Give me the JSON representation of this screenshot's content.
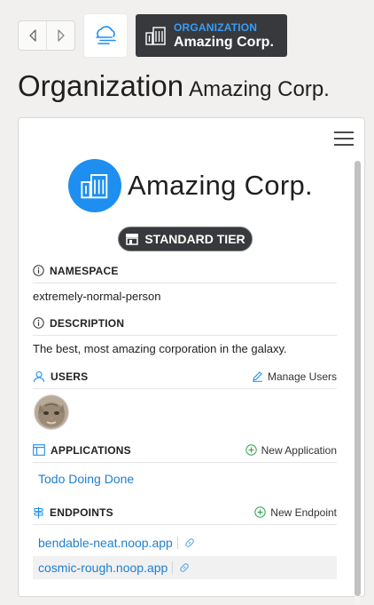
{
  "nav": {
    "back_icon": "arrow-left-icon",
    "forward_icon": "arrow-right-icon",
    "logo_icon": "cloud-lines-icon"
  },
  "breadcrumb": {
    "kicker": "ORGANIZATION",
    "title": "Amazing Corp."
  },
  "page": {
    "title": "Organization",
    "subtitle": "Amazing Corp."
  },
  "org": {
    "name": "Amazing Corp.",
    "tier": "STANDARD TIER"
  },
  "sections": {
    "namespace": {
      "label": "NAMESPACE",
      "value": "extremely-normal-person"
    },
    "description": {
      "label": "DESCRIPTION",
      "value": "The best, most amazing corporation in the galaxy."
    },
    "users": {
      "label": "USERS",
      "action": "Manage Users"
    },
    "applications": {
      "label": "APPLICATIONS",
      "action": "New Application",
      "items": [
        "Todo Doing Done"
      ]
    },
    "endpoints": {
      "label": "ENDPOINTS",
      "action": "New Endpoint",
      "items": [
        "bendable-neat.noop.app",
        "cosmic-rough.noop.app"
      ]
    }
  },
  "colors": {
    "accent": "#1e8ff0",
    "dark": "#37393d",
    "link": "#1f7fcf"
  }
}
